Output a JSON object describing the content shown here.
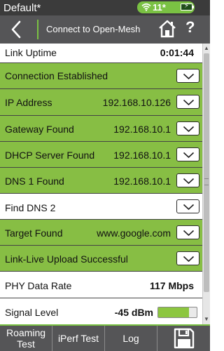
{
  "status_bar": {
    "profile": "Default*",
    "wifi_count": "11*",
    "wifi_icon": "wifi-icon",
    "battery_icon": "battery-charging-icon",
    "accent_color": "#7ac143"
  },
  "header": {
    "title": "Connect to Open-Mesh",
    "back_icon": "chevron-left-icon",
    "home_icon": "home-icon",
    "help_label": "?"
  },
  "rows": {
    "link_uptime": {
      "label": "Link Uptime",
      "value": "0:01:44"
    },
    "connection": {
      "label": "Connection Established"
    },
    "ip": {
      "label": "IP Address",
      "value": "192.168.10.126"
    },
    "gateway": {
      "label": "Gateway Found",
      "value": "192.168.10.1"
    },
    "dhcp": {
      "label": "DHCP Server Found",
      "value": "192.168.10.1"
    },
    "dns1": {
      "label": "DNS 1 Found",
      "value": "192.168.10.1"
    },
    "dns2": {
      "label": "Find DNS 2"
    },
    "target": {
      "label": "Target Found",
      "value": "www.google.com"
    },
    "upload": {
      "label": "Link-Live Upload Successful"
    },
    "phy": {
      "label": "PHY Data Rate",
      "value": "117 Mbps"
    },
    "signal": {
      "label": "Signal Level",
      "value": "-45 dBm",
      "level": 0.8
    }
  },
  "bottom_tabs": {
    "roaming_line1": "Roaming",
    "roaming_line2": "Test",
    "iperf": "iPerf Test",
    "log": "Log",
    "save_icon": "save-icon"
  }
}
